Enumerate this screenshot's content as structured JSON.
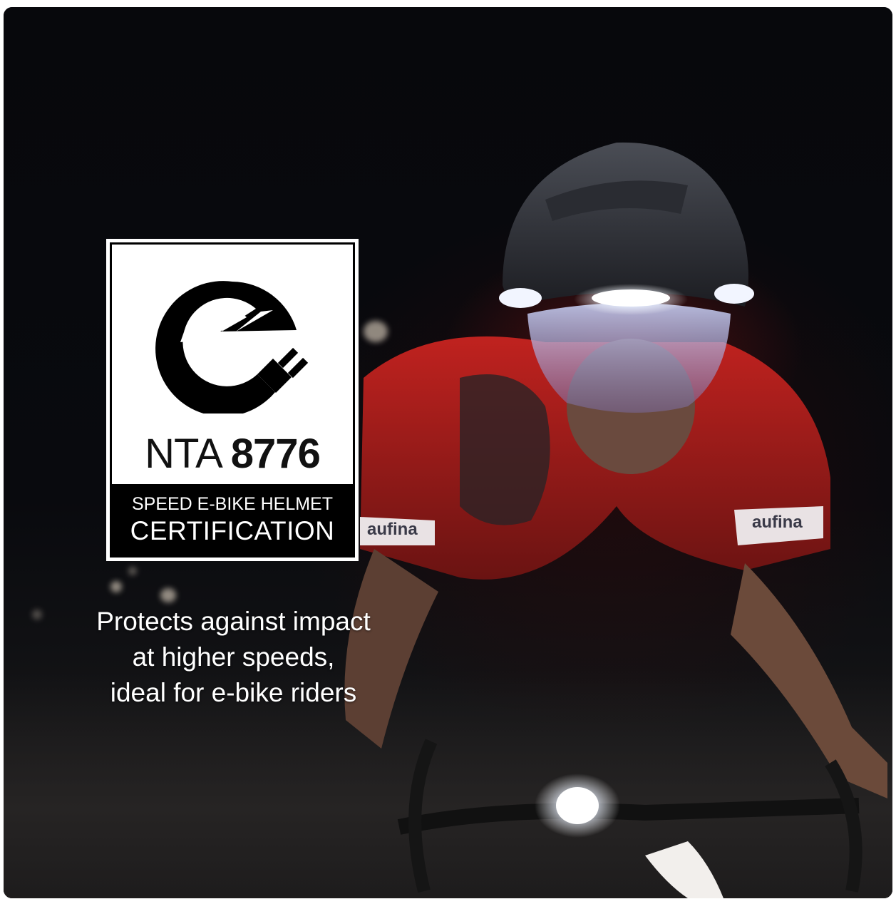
{
  "badge": {
    "logo": "e-bike-plug-logo",
    "code_prefix": "NTA",
    "code_number": "8776",
    "line1": "SPEED E-BIKE HELMET",
    "line2": "CERTIFICATION"
  },
  "jersey_brand": "aufina",
  "tagline": {
    "line1": "Protects against impact",
    "line2": "at higher speeds,",
    "line3": "ideal for e-bike riders"
  }
}
